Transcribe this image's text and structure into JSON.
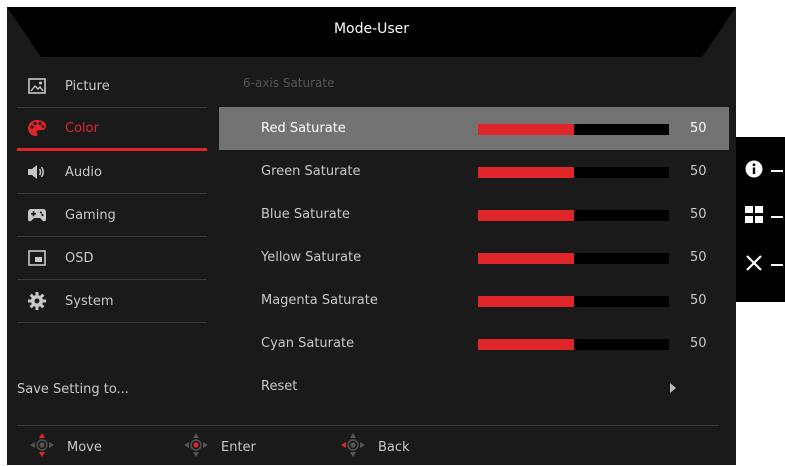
{
  "title": "Mode-User",
  "sidebar": {
    "items": [
      {
        "label": "Picture",
        "icon": "picture-icon",
        "active": false
      },
      {
        "label": "Color",
        "icon": "palette-icon",
        "active": true
      },
      {
        "label": "Audio",
        "icon": "speaker-icon",
        "active": false
      },
      {
        "label": "Gaming",
        "icon": "gamepad-icon",
        "active": false
      },
      {
        "label": "OSD",
        "icon": "osd-icon",
        "active": false
      },
      {
        "label": "System",
        "icon": "gear-icon",
        "active": false
      }
    ],
    "save_label": "Save Setting to..."
  },
  "main": {
    "section_label": "6-axis Saturate",
    "rows": [
      {
        "label": "Red Saturate",
        "value": "50",
        "fill": 0.5,
        "selected": true
      },
      {
        "label": "Green Saturate",
        "value": "50",
        "fill": 0.5
      },
      {
        "label": "Blue Saturate",
        "value": "50",
        "fill": 0.5
      },
      {
        "label": "Yellow Saturate",
        "value": "50",
        "fill": 0.5
      },
      {
        "label": "Magenta Saturate",
        "value": "50",
        "fill": 0.5
      },
      {
        "label": "Cyan Saturate",
        "value": "50",
        "fill": 0.5
      }
    ],
    "reset_label": "Reset"
  },
  "footer": {
    "move_label": "Move",
    "enter_label": "Enter",
    "back_label": "Back"
  },
  "hotkeys": [
    "info-icon",
    "grid-icon",
    "close-icon"
  ],
  "colors": {
    "accent": "#e0262a",
    "panel": "#1a1a1a",
    "selected_row": "#737373"
  }
}
